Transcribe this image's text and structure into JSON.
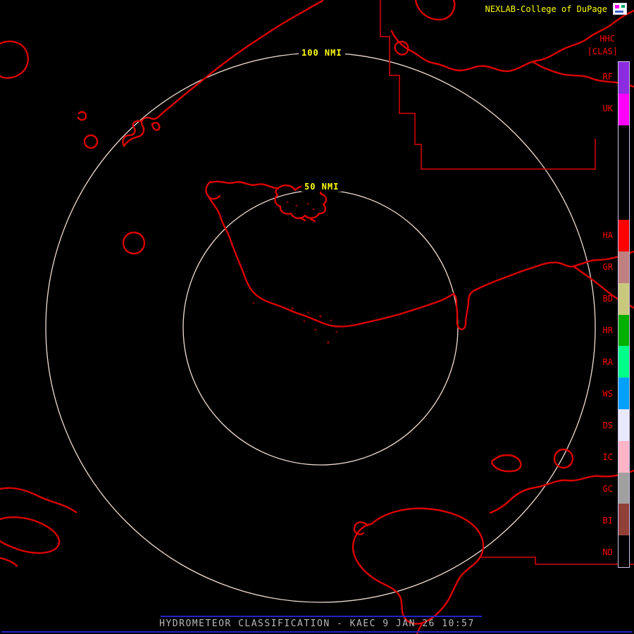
{
  "colors": {
    "background": "#000000",
    "map_outline": "#dd0202",
    "range_ring": "#f2dcd2",
    "ring_label": "#ffff00",
    "brand_text": "#ffff00",
    "legend_label_text": "#ff0000",
    "legend_border": "#cfc6ea",
    "footer_line": "#2222cc",
    "footer_text": "#b8b8b8"
  },
  "header": {
    "brand": "NEXLAB-College of DuPage"
  },
  "legend": {
    "product": "HHC",
    "mode": "[CLAS]",
    "segments": [
      {
        "label": "RF",
        "color": "#8c2be0"
      },
      {
        "label": "UK",
        "color": "#ff00ff"
      },
      {
        "label": "",
        "color": "#000000"
      },
      {
        "label": "",
        "color": "#000000"
      },
      {
        "label": "",
        "color": "#000000"
      },
      {
        "label": "HA",
        "color": "#ff0000"
      },
      {
        "label": "GR",
        "color": "#c08080"
      },
      {
        "label": "BD",
        "color": "#c9c97e"
      },
      {
        "label": "HR",
        "color": "#00b000"
      },
      {
        "label": "RA",
        "color": "#00ff88"
      },
      {
        "label": "WS",
        "color": "#00a0ff"
      },
      {
        "label": "DS",
        "color": "#e8e8fa"
      },
      {
        "label": "IC",
        "color": "#ffb4c8"
      },
      {
        "label": "GC",
        "color": "#a0a0a0"
      },
      {
        "label": "BI",
        "color": "#904038"
      },
      {
        "label": "ND",
        "color": "#000000"
      }
    ]
  },
  "map": {
    "rings": [
      {
        "label": "100 NMI"
      },
      {
        "label": "50 NMI"
      }
    ]
  },
  "footer": {
    "caption": "HYDROMETEOR CLASSIFICATION - KAEC 9 JAN 26 10:57"
  }
}
